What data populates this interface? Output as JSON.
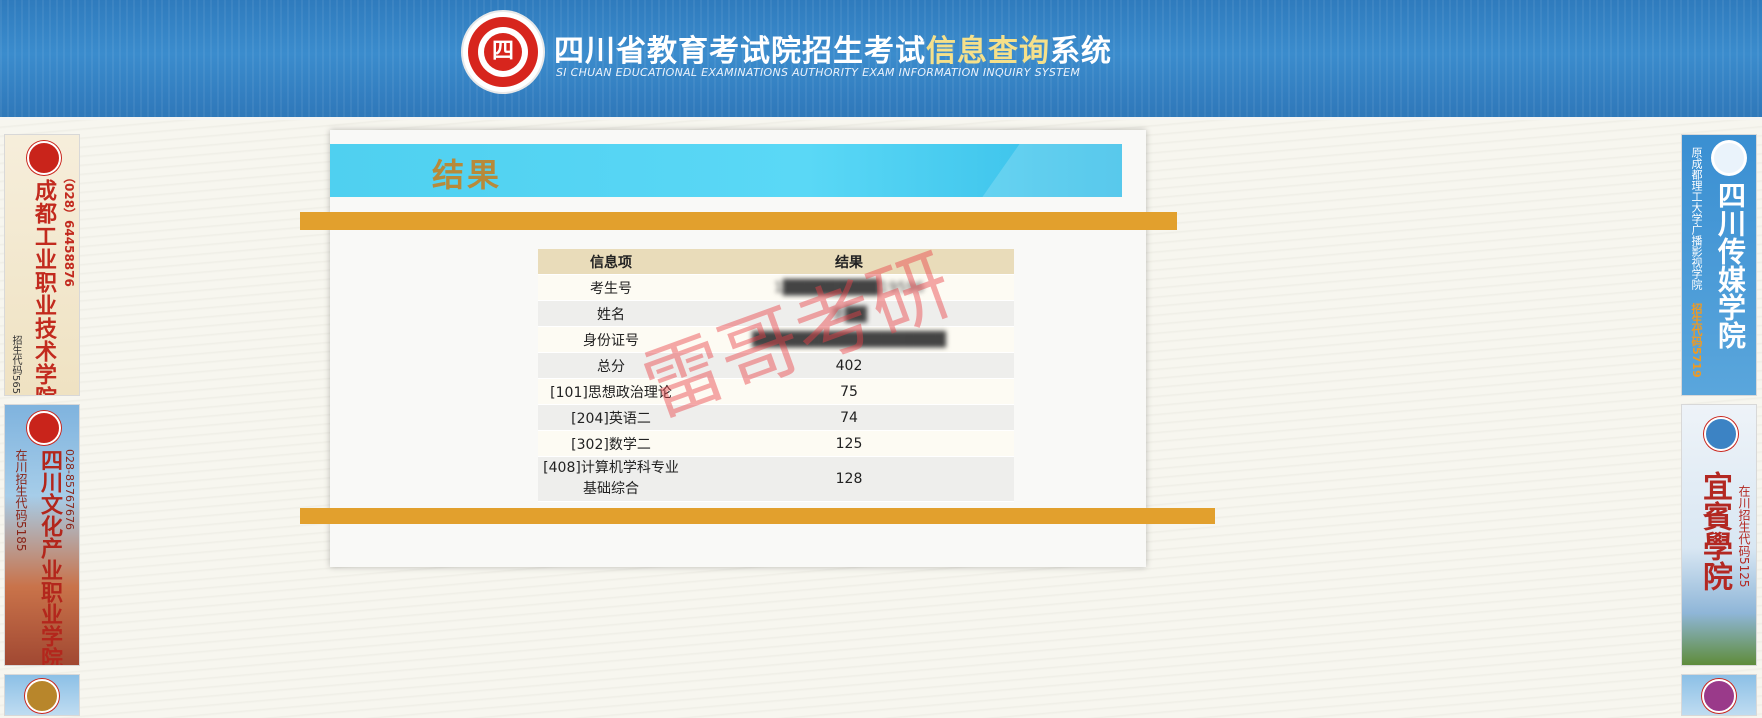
{
  "header": {
    "title_cn_main": "四川省教育考试院招生考试",
    "title_cn_highlight": "信息查询",
    "title_cn_tail": "系统",
    "title_en": "SI CHUAN EDUCATIONAL EXAMINATIONS AUTHORITY EXAM INFORMATION INQUIRY SYSTEM",
    "seal_glyph": "四",
    "colors": {
      "background": "#2f7bbd",
      "highlight": "#f5e08a"
    }
  },
  "ads": {
    "left_top": {
      "name": "成都工业职业技术学院",
      "phone": "（028）64458876",
      "code": "招生代码5657"
    },
    "left_mid": {
      "name": "四川文化产业职业学院",
      "phone": "028-85767676",
      "code": "在川招生代码5185"
    },
    "right_top": {
      "name": "四川传媒学院",
      "subtitle": "原成都理工大学广播影视学院",
      "code": "招生代码5719"
    },
    "right_mid": {
      "name": "宜賓學院",
      "code": "在川招生代码5125"
    }
  },
  "result": {
    "title": "结果",
    "columns": [
      "信息项",
      "结果"
    ],
    "rows": [
      {
        "label": "考生号",
        "value": "1█████████19596",
        "masked": true
      },
      {
        "label": "姓名",
        "value": "李██",
        "masked": true
      },
      {
        "label": "身份证号",
        "value": "██████████████████",
        "masked": true
      },
      {
        "label": "总分",
        "value": "402"
      },
      {
        "label": "[101]思想政治理论",
        "value": "75"
      },
      {
        "label": "[204]英语二",
        "value": "74"
      },
      {
        "label": "[302]数学二",
        "value": "125"
      },
      {
        "label": "[408]计算机学科专业基础综合",
        "value": "128"
      }
    ]
  },
  "watermark": "雷哥考研"
}
